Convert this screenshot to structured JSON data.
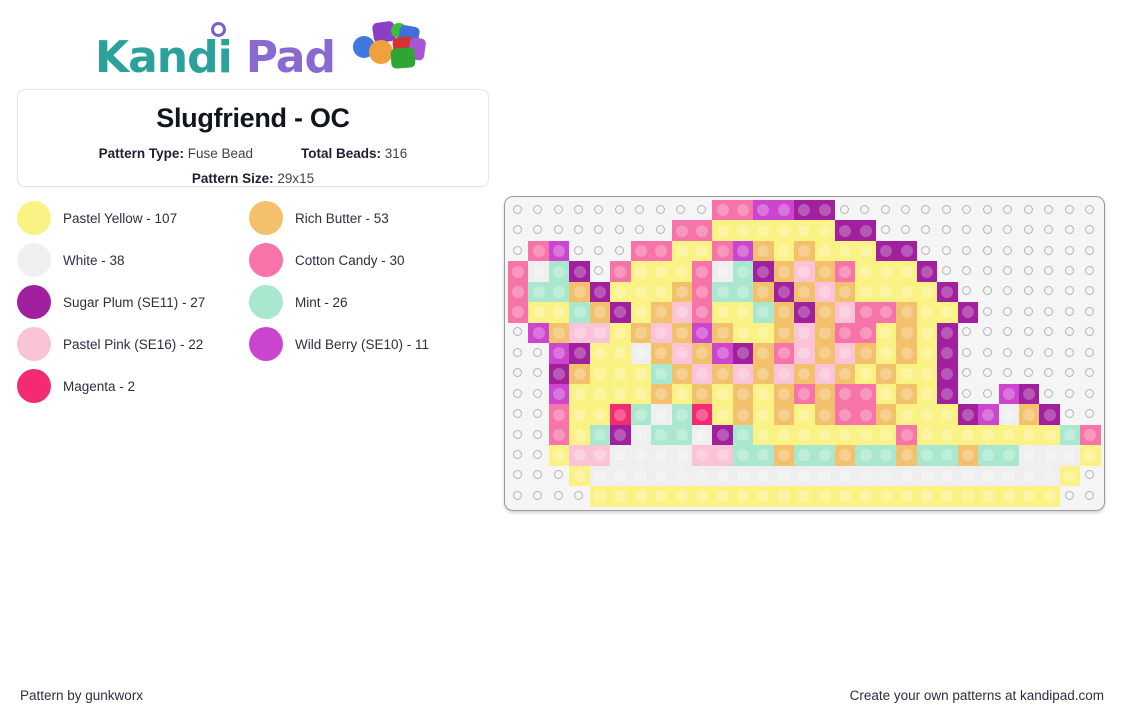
{
  "brand": {
    "name_part1": "Kandi",
    "name_part2": "Pad",
    "logo_icon": "kandi-beads-icon",
    "teal": "#2aa19a",
    "purple": "#8a6ad1"
  },
  "info": {
    "title": "Slugfriend - OC",
    "pattern_type_label": "Pattern Type:",
    "pattern_type_value": "Fuse Bead",
    "total_beads_label": "Total Beads:",
    "total_beads_value": "316",
    "pattern_size_label": "Pattern Size:",
    "pattern_size_value": "29x15"
  },
  "legend": [
    {
      "name": "Pastel Yellow",
      "count": "107",
      "label": "Pastel Yellow - 107",
      "color": "#fbf285"
    },
    {
      "name": "Rich Butter",
      "count": "53",
      "label": "Rich Butter - 53",
      "color": "#f3c06b"
    },
    {
      "name": "White",
      "count": "38",
      "label": "White - 38",
      "color": "#efefef"
    },
    {
      "name": "Cotton Candy",
      "count": "30",
      "label": "Cotton Candy - 30",
      "color": "#f774a8"
    },
    {
      "name": "Sugar Plum (SE11)",
      "count": "27",
      "label": "Sugar Plum (SE11) - 27",
      "color": "#a0209e"
    },
    {
      "name": "Mint",
      "count": "26",
      "label": "Mint - 26",
      "color": "#a9e8cf"
    },
    {
      "name": "Pastel Pink (SE16)",
      "count": "22",
      "label": "Pastel Pink (SE16) - 22",
      "color": "#fac3d8"
    },
    {
      "name": "Wild Berry (SE10)",
      "count": "11",
      "label": "Wild Berry (SE10) - 11",
      "color": "#cc45cf"
    },
    {
      "name": "Magenta",
      "count": "2",
      "label": "Magenta - 2",
      "color": "#f42b73"
    }
  ],
  "palette": {
    "_": null,
    "Y": "#fbf285",
    "B": "#f3c06b",
    "W": "#efefef",
    "C": "#f774a8",
    "S": "#a0209e",
    "M": "#a9e8cf",
    "P": "#fac3d8",
    "R": "#cc45cf",
    "G": "#f42b73"
  },
  "grid": {
    "columns": 29,
    "rows": 15,
    "cells": [
      [
        "_",
        "_",
        "_",
        "_",
        "_",
        "_",
        "_",
        "_",
        "_",
        "_",
        "C",
        "C",
        "R",
        "R",
        "S",
        "S",
        "_",
        "_",
        "_",
        "_",
        "_",
        "_",
        "_",
        "_",
        "_",
        "_",
        "_",
        "_",
        "_"
      ],
      [
        "_",
        "_",
        "_",
        "_",
        "_",
        "_",
        "_",
        "_",
        "C",
        "C",
        "Y",
        "Y",
        "Y",
        "Y",
        "Y",
        "Y",
        "S",
        "S",
        "_",
        "_",
        "_",
        "_",
        "_",
        "_",
        "_",
        "_",
        "_",
        "_",
        "_"
      ],
      [
        "_",
        "C",
        "R",
        "_",
        "_",
        "_",
        "C",
        "C",
        "Y",
        "Y",
        "C",
        "R",
        "B",
        "Y",
        "B",
        "Y",
        "Y",
        "Y",
        "S",
        "S",
        "_",
        "_",
        "_",
        "_",
        "_",
        "_",
        "_",
        "_",
        "_"
      ],
      [
        "C",
        "W",
        "M",
        "S",
        "_",
        "C",
        "Y",
        "Y",
        "Y",
        "C",
        "W",
        "M",
        "S",
        "B",
        "P",
        "B",
        "C",
        "Y",
        "Y",
        "Y",
        "S",
        "_",
        "_",
        "_",
        "_",
        "_",
        "_",
        "_",
        "_"
      ],
      [
        "C",
        "M",
        "M",
        "B",
        "S",
        "Y",
        "Y",
        "Y",
        "B",
        "C",
        "M",
        "M",
        "B",
        "S",
        "B",
        "P",
        "B",
        "Y",
        "Y",
        "Y",
        "Y",
        "S",
        "_",
        "_",
        "_",
        "_",
        "_",
        "_",
        "_"
      ],
      [
        "C",
        "Y",
        "Y",
        "M",
        "B",
        "S",
        "Y",
        "B",
        "P",
        "C",
        "Y",
        "Y",
        "M",
        "B",
        "S",
        "B",
        "P",
        "C",
        "C",
        "B",
        "Y",
        "Y",
        "S",
        "_",
        "_",
        "_",
        "_",
        "_",
        "_"
      ],
      [
        "_",
        "R",
        "B",
        "P",
        "P",
        "Y",
        "B",
        "P",
        "B",
        "R",
        "B",
        "Y",
        "Y",
        "B",
        "P",
        "B",
        "C",
        "C",
        "Y",
        "B",
        "Y",
        "S",
        "_",
        "_",
        "_",
        "_",
        "_",
        "_",
        "_"
      ],
      [
        "_",
        "_",
        "R",
        "S",
        "Y",
        "Y",
        "W",
        "B",
        "P",
        "B",
        "R",
        "S",
        "B",
        "C",
        "P",
        "B",
        "P",
        "B",
        "Y",
        "B",
        "Y",
        "S",
        "_",
        "_",
        "_",
        "_",
        "_",
        "_",
        "_"
      ],
      [
        "_",
        "_",
        "S",
        "B",
        "Y",
        "Y",
        "Y",
        "M",
        "B",
        "P",
        "B",
        "P",
        "B",
        "P",
        "B",
        "P",
        "B",
        "Y",
        "B",
        "Y",
        "Y",
        "S",
        "_",
        "_",
        "_",
        "_",
        "_",
        "_",
        "_"
      ],
      [
        "_",
        "_",
        "R",
        "Y",
        "Y",
        "Y",
        "Y",
        "B",
        "Y",
        "B",
        "Y",
        "B",
        "Y",
        "B",
        "C",
        "B",
        "C",
        "C",
        "Y",
        "B",
        "Y",
        "S",
        "_",
        "_",
        "R",
        "S",
        "_",
        "_",
        "_"
      ],
      [
        "_",
        "_",
        "C",
        "Y",
        "Y",
        "G",
        "M",
        "W",
        "M",
        "G",
        "Y",
        "B",
        "Y",
        "B",
        "Y",
        "B",
        "C",
        "C",
        "B",
        "Y",
        "Y",
        "Y",
        "S",
        "R",
        "W",
        "B",
        "S",
        "_",
        "_"
      ],
      [
        "_",
        "_",
        "C",
        "Y",
        "M",
        "S",
        "W",
        "M",
        "M",
        "W",
        "S",
        "M",
        "Y",
        "Y",
        "Y",
        "Y",
        "Y",
        "Y",
        "Y",
        "C",
        "Y",
        "Y",
        "Y",
        "Y",
        "Y",
        "Y",
        "Y",
        "M",
        "C"
      ],
      [
        "_",
        "_",
        "Y",
        "P",
        "P",
        "W",
        "W",
        "W",
        "W",
        "P",
        "P",
        "M",
        "M",
        "B",
        "M",
        "M",
        "B",
        "M",
        "M",
        "B",
        "M",
        "M",
        "B",
        "M",
        "M",
        "W",
        "W",
        "W",
        "Y"
      ],
      [
        "_",
        "_",
        "_",
        "Y",
        "W",
        "W",
        "W",
        "W",
        "W",
        "W",
        "W",
        "W",
        "W",
        "W",
        "W",
        "W",
        "W",
        "W",
        "W",
        "W",
        "W",
        "W",
        "W",
        "W",
        "W",
        "W",
        "W",
        "Y",
        "_"
      ],
      [
        "_",
        "_",
        "_",
        "_",
        "Y",
        "Y",
        "Y",
        "Y",
        "Y",
        "Y",
        "Y",
        "Y",
        "Y",
        "Y",
        "Y",
        "Y",
        "Y",
        "Y",
        "Y",
        "Y",
        "Y",
        "Y",
        "Y",
        "Y",
        "Y",
        "Y",
        "Y",
        "_",
        "_"
      ]
    ]
  },
  "footer": {
    "credit": "Pattern by gunkworx",
    "promo": "Create your own patterns at kandipad.com"
  }
}
